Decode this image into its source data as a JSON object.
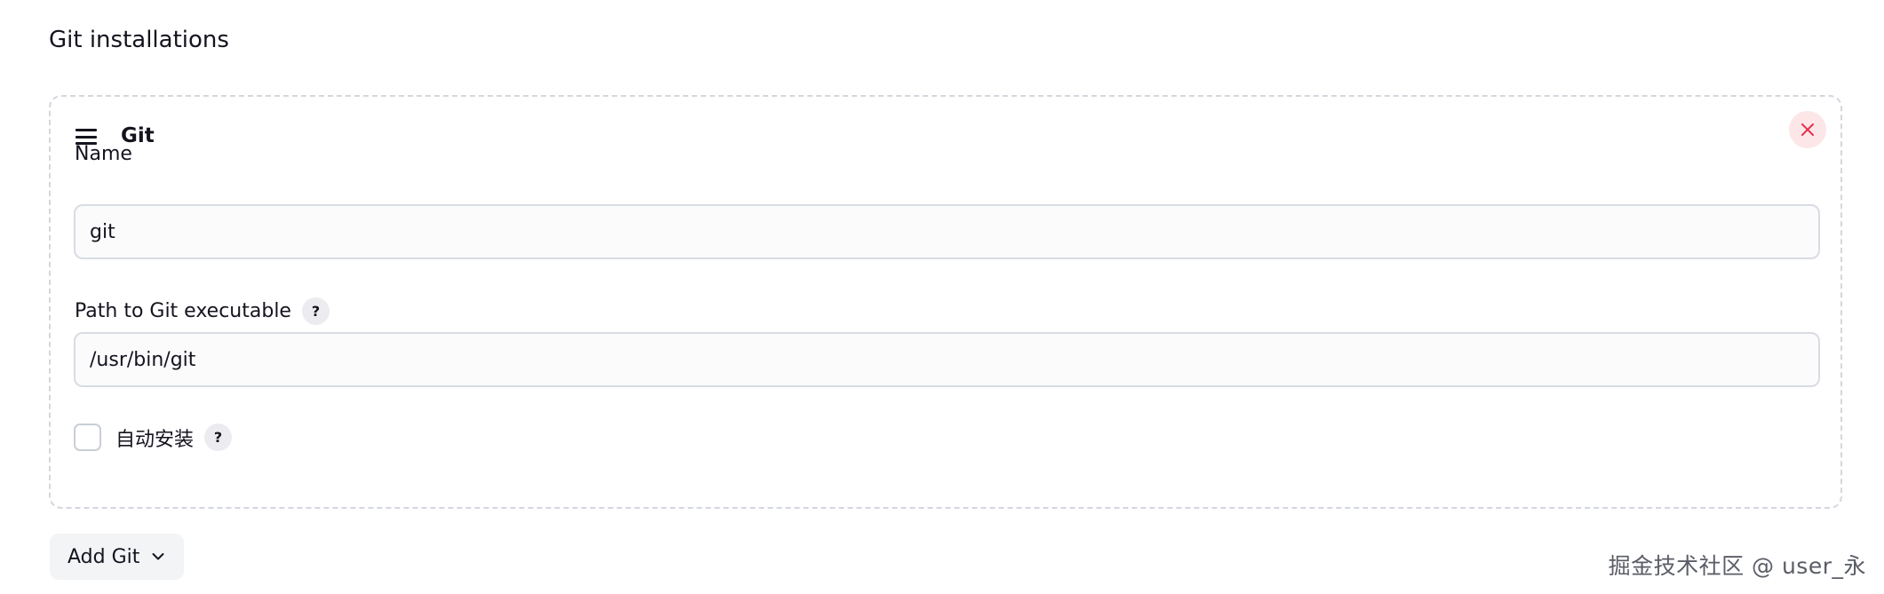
{
  "section": {
    "title": "Git installations"
  },
  "installation": {
    "title": "Git",
    "name_label": "Name",
    "name_value": "git",
    "path_label": "Path to Git executable",
    "path_value": "/usr/bin/git",
    "auto_install_label": "自动安装",
    "auto_install_checked": false,
    "help_glyph": "?"
  },
  "add_button": {
    "label": "Add Git"
  },
  "watermark": {
    "text": "掘金技术社区 @ user_永"
  },
  "icons": {
    "drag": "drag-handle-icon",
    "close": "close-icon",
    "help": "help-icon",
    "chevron": "chevron-down-icon"
  },
  "colors": {
    "text": "#14141f",
    "dashed_border": "#d3d7de",
    "delete_bg": "#fde6e8",
    "delete_icon": "#e5304d",
    "input_border": "#d8dce3",
    "button_bg": "#f3f4f6"
  }
}
